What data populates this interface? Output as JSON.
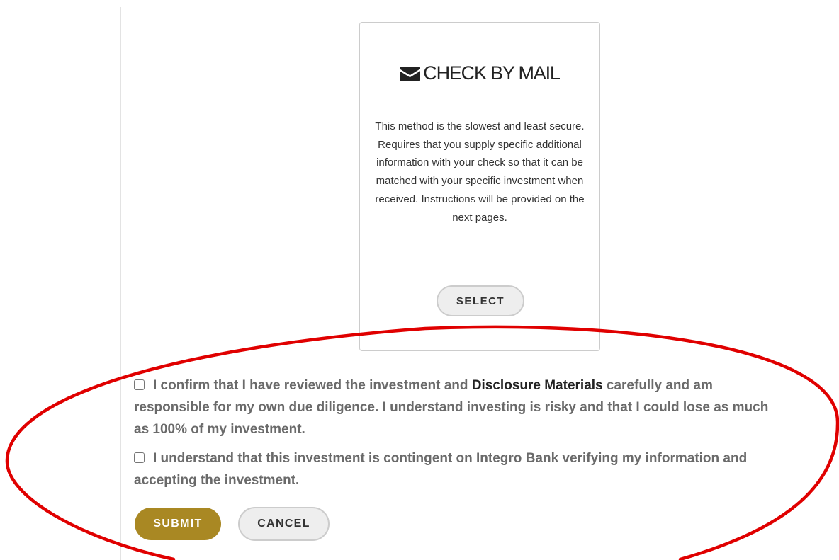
{
  "payment_method": {
    "icon": "envelope-icon",
    "title": "CHECK BY MAIL",
    "description": "This method is the slowest and least secure. Requires that you supply specific additional information with your check so that it can be matched with your specific investment when received. Instructions will be provided on the next pages.",
    "select_label": "SELECT"
  },
  "agreements": [
    {
      "checked": false,
      "text_before": "I confirm that I have reviewed the investment and",
      "link_text": "Disclosure Materials",
      "text_after": "carefully and am responsible for my own due diligence. I understand investing is risky and that I could lose as much as 100% of my investment."
    },
    {
      "checked": false,
      "text": "I understand that this investment is contingent on Integro Bank verifying my information and accepting the investment."
    }
  ],
  "actions": {
    "submit_label": "SUBMIT",
    "cancel_label": "CANCEL"
  },
  "colors": {
    "submit_background": "#a98823",
    "annotation_ellipse": "#e00000"
  }
}
